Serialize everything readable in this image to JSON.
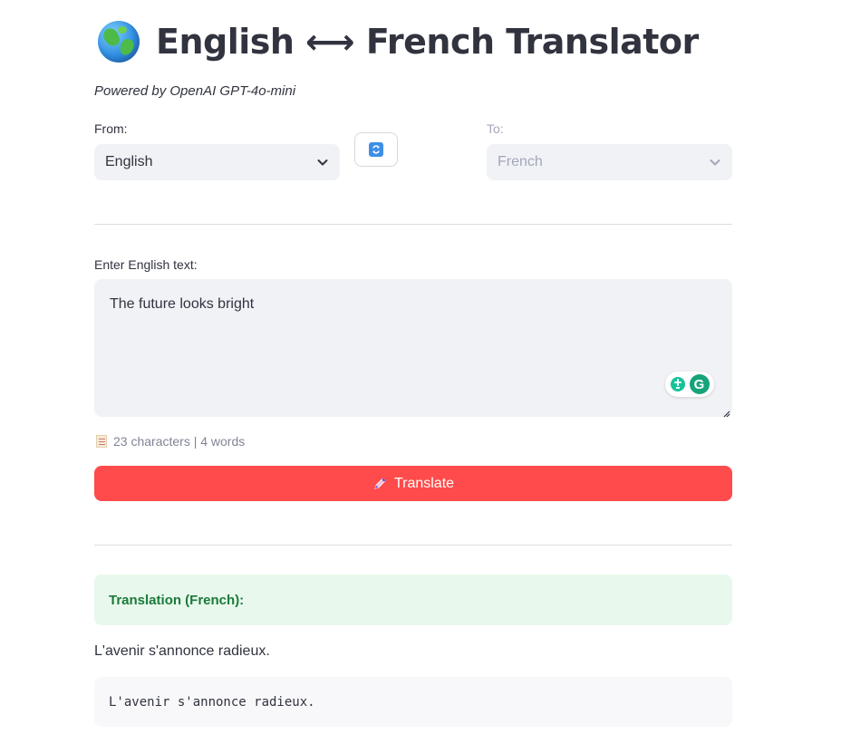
{
  "header": {
    "icon": "globe-icon",
    "title": "English ⟷ French Translator",
    "subtitle": "Powered by OpenAI GPT-4o-mini"
  },
  "from": {
    "label": "From:",
    "selected": "English"
  },
  "swap": {
    "icon": "swap-arrows-icon"
  },
  "to": {
    "label": "To:",
    "selected": "French",
    "disabled": true
  },
  "input": {
    "label": "Enter English text:",
    "value": "The future looks bright"
  },
  "counter": {
    "icon": "memo-icon",
    "text": "23 characters | 4 words"
  },
  "translate_button": {
    "icon": "pen-icon",
    "label": "Translate"
  },
  "result": {
    "heading": "Translation (French):",
    "text": "L'avenir s'annonce radieux.",
    "code": "L'avenir s'annonce radieux."
  },
  "colors": {
    "primary": "#ff4b4b",
    "success_bg": "#e8f8ec",
    "success_text": "#1b7a3a",
    "input_bg": "#f0f2f6"
  }
}
